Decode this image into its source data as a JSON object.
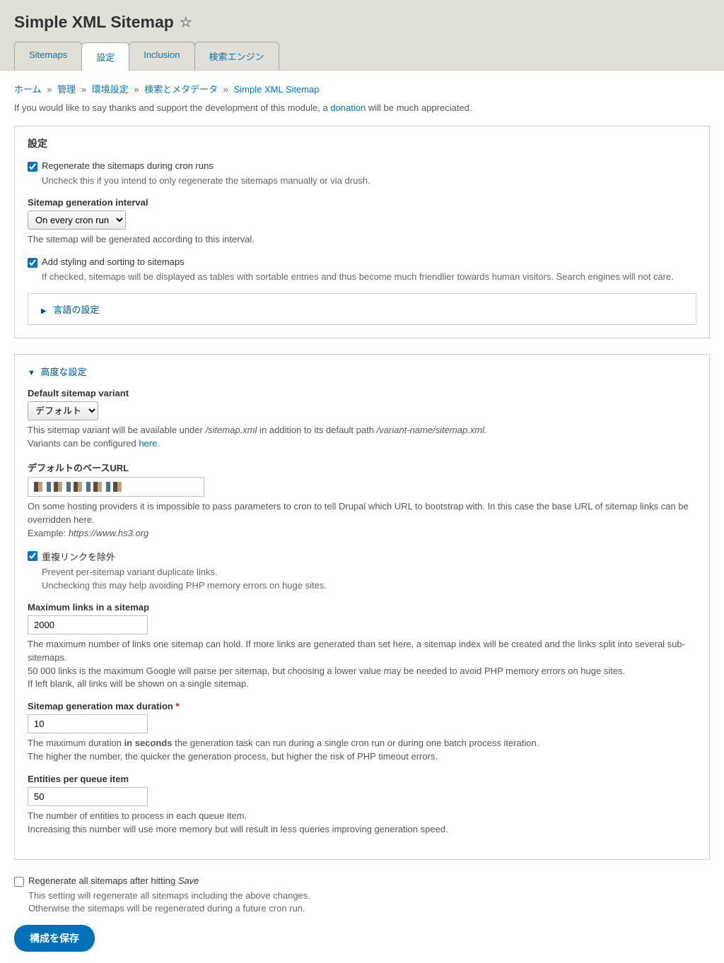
{
  "page_title": "Simple XML Sitemap",
  "tabs": [
    {
      "label": "Sitemaps",
      "active": false
    },
    {
      "label": "設定",
      "active": true
    },
    {
      "label": "Inclusion",
      "active": false
    },
    {
      "label": "検索エンジン",
      "active": false
    }
  ],
  "breadcrumb": [
    {
      "label": "ホーム"
    },
    {
      "label": "管理"
    },
    {
      "label": "環境設定"
    },
    {
      "label": "検索とメタデータ"
    },
    {
      "label": "Simple XML Sitemap"
    }
  ],
  "intro": {
    "text1": "If you would like to say thanks and support the development of this module, a ",
    "donation_link": "donation",
    "text2": " will be much appreciated."
  },
  "settings_panel": {
    "title": "設定",
    "regenerate_cron": {
      "label": "Regenerate the sitemaps during cron runs",
      "description": "Uncheck this if you intend to only regenerate the sitemaps manually or via drush.",
      "checked": true
    },
    "interval": {
      "label": "Sitemap generation interval",
      "value": "On every cron run",
      "description": "The sitemap will be generated according to this interval."
    },
    "styling": {
      "label": "Add styling and sorting to sitemaps",
      "description": "If checked, sitemaps will be displayed as tables with sortable entries and thus become much friendlier towards human visitors. Search engines will not care.",
      "checked": true
    },
    "language_details": "言語の設定"
  },
  "advanced_panel": {
    "title": "高度な設定",
    "default_variant": {
      "label": "Default sitemap variant",
      "value": "デフォルト",
      "desc1": "This sitemap variant will be available under ",
      "desc_path1": "/sitemap.xml",
      "desc2": " in addition to its default path ",
      "desc_path2": "/variant-name/sitemap.xml",
      "desc3": ".",
      "desc_line2a": "Variants can be configured ",
      "desc_here": "here",
      "desc_line2b": "."
    },
    "base_url": {
      "label": "デフォルトのベースURL",
      "desc1": "On some hosting providers it is impossible to pass parameters to cron to tell Drupal which URL to bootstrap with. In this case the base URL of sitemap links can be overridden here.",
      "desc2a": "Example: ",
      "desc2b": "https://www.hs3.org"
    },
    "exclude_dup": {
      "label": "重複リンクを除外",
      "desc1": "Prevent per-sitemap variant duplicate links.",
      "desc2": "Unchecking this may help avoiding PHP memory errors on huge sites.",
      "checked": true
    },
    "max_links": {
      "label": "Maximum links in a sitemap",
      "value": "2000",
      "desc1": "The maximum number of links one sitemap can hold. If more links are generated than set here, a sitemap index will be created and the links split into several sub-sitemaps.",
      "desc2": "50 000 links is the maximum Google will parse per sitemap, but choosing a lower value may be needed to avoid PHP memory errors on huge sites.",
      "desc3": "If left blank, all links will be shown on a single sitemap."
    },
    "max_duration": {
      "label": "Sitemap generation max duration",
      "value": "10",
      "desc1a": "The maximum duration ",
      "desc1b": "in seconds",
      "desc1c": " the generation task can run during a single cron run or during one batch process iteration.",
      "desc2": "The higher the number, the quicker the generation process, but higher the risk of PHP timeout errors."
    },
    "entities_queue": {
      "label": "Entities per queue item",
      "value": "50",
      "desc1": "The number of entities to process in each queue item.",
      "desc2": "Increasing this number will use more memory but will result in less queries improving generation speed."
    }
  },
  "regenerate_all": {
    "label_a": "Regenerate all sitemaps after hitting ",
    "label_b": "Save",
    "desc1": "This setting will regenerate all sitemaps including the above changes.",
    "desc2": "Otherwise the sitemaps will be regenerated during a future cron run.",
    "checked": false
  },
  "save_button": "構成を保存"
}
